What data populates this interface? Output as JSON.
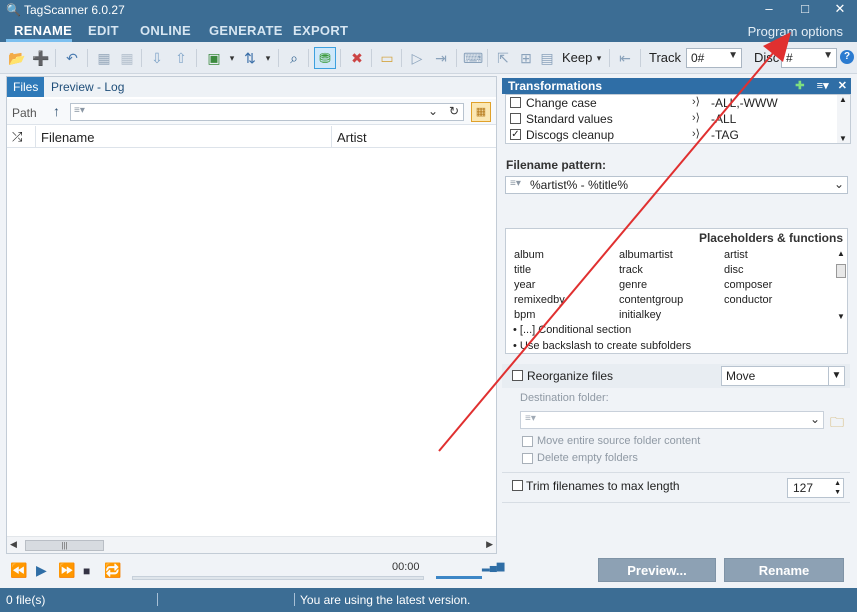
{
  "app": {
    "title": "TagScanner 6.0.27",
    "window_controls": [
      "–",
      "□",
      "✕"
    ]
  },
  "menu": {
    "tabs": [
      "RENAME",
      "EDIT",
      "ONLINE",
      "GENERATE",
      "EXPORT"
    ],
    "active_tab": "RENAME",
    "program_options": "Program options"
  },
  "toolbar": {
    "keep_label": "Keep",
    "track_label": "Track",
    "track_value": "0#",
    "disc_label": "Disc",
    "disc_value": "#",
    "help_label": "?"
  },
  "left": {
    "tabs": [
      "Files",
      "Preview - Log"
    ],
    "active_tab": "Files",
    "path_label": "Path",
    "path_value": "",
    "columns": [
      "Filename",
      "Artist"
    ]
  },
  "player": {
    "time": "00:00",
    "progress": 0
  },
  "transformations": {
    "title": "Transformations",
    "items": [
      {
        "label": "Change case",
        "checked": false,
        "value": "-ALL,-WWW"
      },
      {
        "label": "Standard values",
        "checked": false,
        "value": "-ALL"
      },
      {
        "label": "Discogs cleanup",
        "checked": true,
        "value": "-TAG"
      }
    ]
  },
  "filename_pattern": {
    "label": "Filename pattern:",
    "value": "%artist% - %title%"
  },
  "placeholders": {
    "title": "Placeholders & functions",
    "items": [
      "album",
      "albumartist",
      "artist",
      "title",
      "track",
      "disc",
      "year",
      "genre",
      "composer",
      "remixedby",
      "contentgroup",
      "conductor",
      "bpm",
      "initialkey",
      ""
    ],
    "notes": [
      "• [...] Conditional section",
      "• Use backslash to create subfolders"
    ]
  },
  "reorganize": {
    "label": "Reorganize files",
    "checked": false,
    "mode": "Move",
    "destination_label": "Destination folder:",
    "destination_value": "",
    "move_entire": "Move entire source folder content",
    "delete_empty": "Delete empty folders"
  },
  "trim": {
    "label": "Trim filenames to max length",
    "checked": false,
    "value": "127"
  },
  "buttons": {
    "preview": "Preview...",
    "rename": "Rename"
  },
  "status": {
    "files": "0 file(s)",
    "message": "You are using the latest version."
  },
  "colors": {
    "titlebar": "#3c6d94",
    "accent": "#2f6ea6",
    "arrow": "#e03030"
  }
}
